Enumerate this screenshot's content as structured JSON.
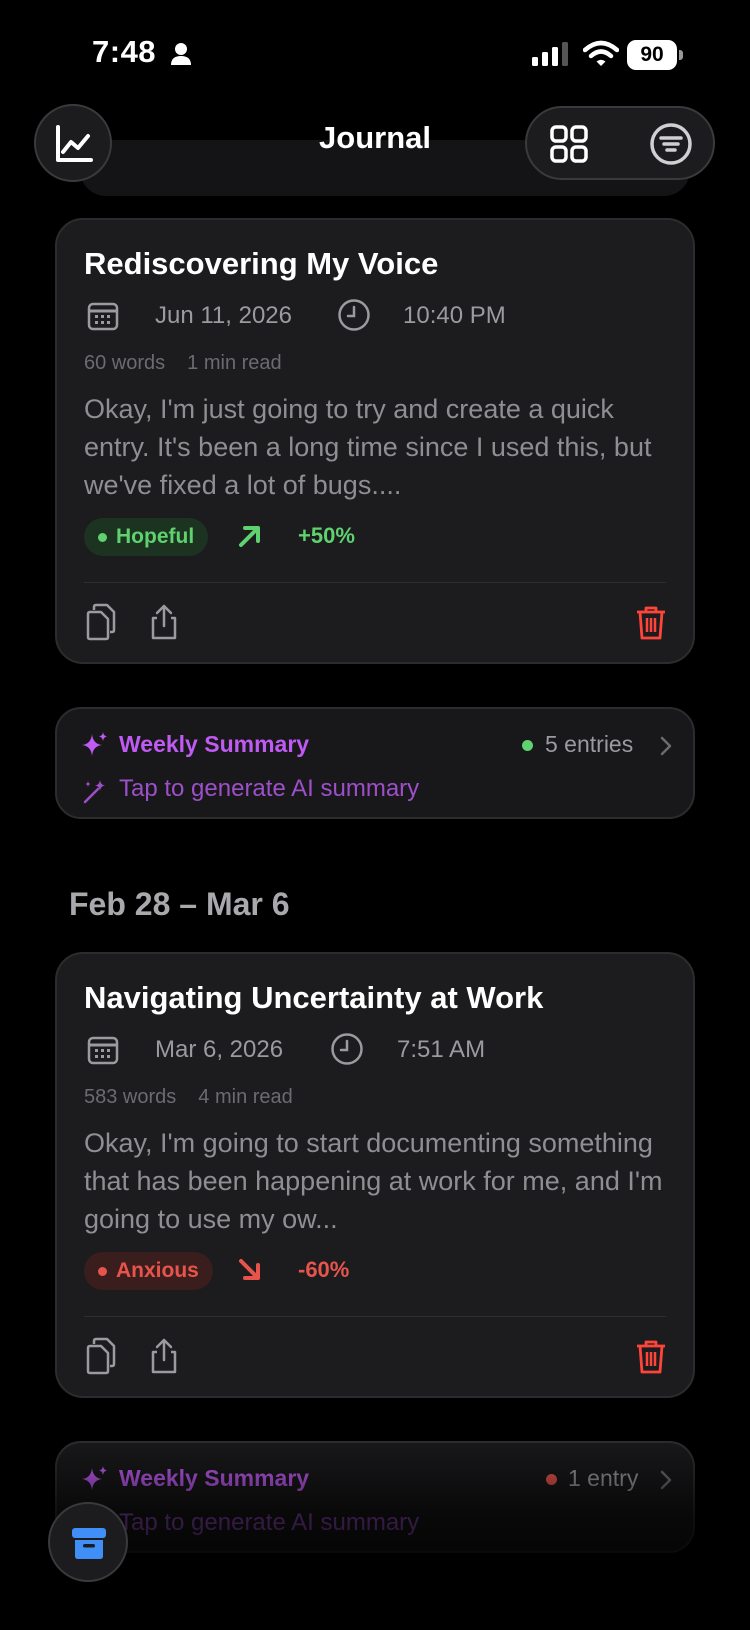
{
  "status_bar": {
    "time": "7:48",
    "battery": "90"
  },
  "header": {
    "title": "Journal"
  },
  "entries": [
    {
      "title": "Rediscovering My Voice",
      "date": "Jun 11, 2026",
      "time": "10:40 PM",
      "words": "60 words",
      "read_time": "1 min read",
      "excerpt": "Okay, I'm just going to try and create a quick entry. It's been a long time since I used this, but we've fixed a lot of bugs....",
      "mood": "Hopeful",
      "mood_color": "#5fd16f",
      "trend": "+50%",
      "trend_direction": "up"
    },
    {
      "title": "Navigating Uncertainty at Work",
      "date": "Mar 6, 2026",
      "time": "7:51 AM",
      "words": "583 words",
      "read_time": "4 min read",
      "excerpt": "Okay, I'm going to start documenting something that has been happening at work for me, and I'm going to use my ow...",
      "mood": "Anxious",
      "mood_color": "#e8544b",
      "trend": "-60%",
      "trend_direction": "down"
    }
  ],
  "weekly_summaries": [
    {
      "title": "Weekly Summary",
      "count": "5 entries",
      "dot_color": "#5fd16f",
      "subtitle": "Tap to generate AI summary"
    },
    {
      "title": "Weekly Summary",
      "count": "1 entry",
      "dot_color": "#e8544b",
      "subtitle": "Tap to generate AI summary"
    }
  ],
  "sections": [
    {
      "label": "Feb 28 – Mar 6"
    }
  ],
  "colors": {
    "accent_purple": "#bf5af2",
    "delete_red": "#ff453a",
    "background": "#000000",
    "card": "#1c1c1e"
  }
}
